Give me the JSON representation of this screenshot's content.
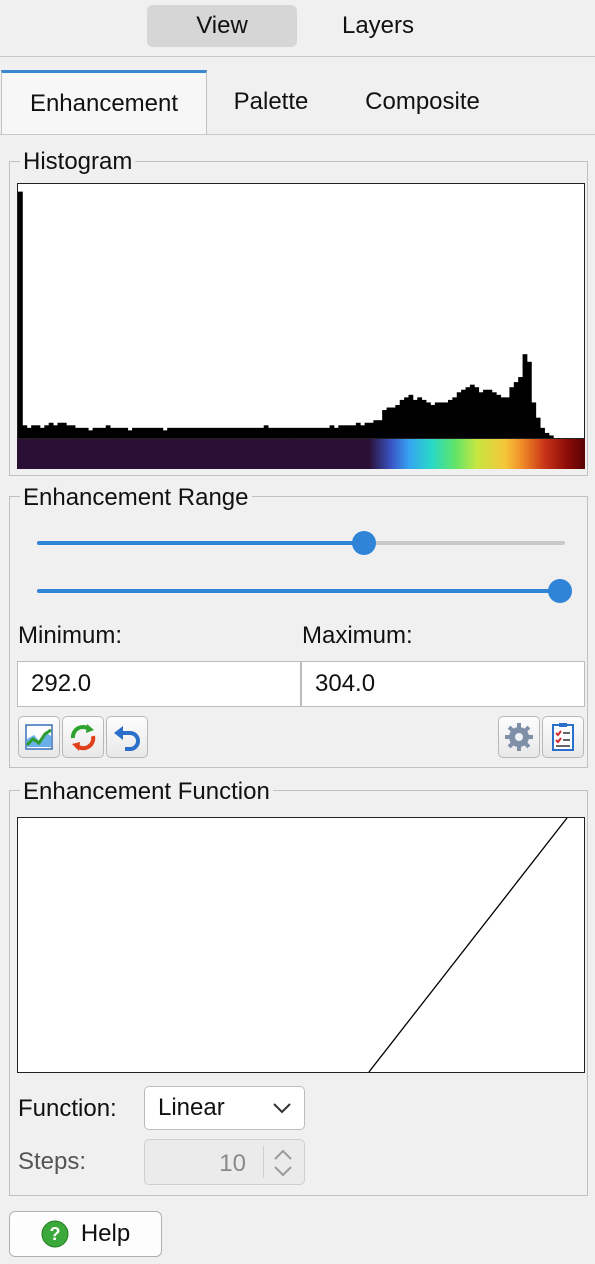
{
  "top_tabs": {
    "view": "View",
    "layers": "Layers"
  },
  "tabs": {
    "enhancement": "Enhancement",
    "palette": "Palette",
    "composite": "Composite"
  },
  "histogram": {
    "title": "Histogram",
    "bins": [
      97,
      5,
      4,
      5,
      5,
      4,
      5,
      6,
      5,
      6,
      6,
      5,
      5,
      4,
      4,
      4,
      3,
      4,
      4,
      4,
      5,
      4,
      4,
      4,
      4,
      3,
      4,
      4,
      4,
      4,
      4,
      4,
      4,
      3,
      4,
      4,
      4,
      4,
      4,
      4,
      4,
      4,
      4,
      4,
      4,
      4,
      4,
      4,
      4,
      4,
      4,
      4,
      4,
      4,
      4,
      4,
      5,
      4,
      4,
      4,
      4,
      4,
      4,
      4,
      4,
      4,
      4,
      4,
      4,
      4,
      4,
      5,
      4,
      5,
      5,
      5,
      5,
      6,
      5,
      6,
      6,
      7,
      7,
      11,
      12,
      12,
      13,
      15,
      16,
      17,
      15,
      16,
      15,
      14,
      13,
      14,
      14,
      14,
      15,
      16,
      18,
      19,
      20,
      21,
      20,
      18,
      19,
      19,
      18,
      17,
      16,
      16,
      20,
      22,
      24,
      33,
      30,
      14,
      8,
      4,
      2,
      1,
      0,
      0,
      0,
      0,
      0,
      0,
      0
    ]
  },
  "range": {
    "title": "Enhancement Range",
    "min_slider_fraction": 0.62,
    "max_slider_fraction": 0.99,
    "minimum_label": "Minimum:",
    "maximum_label": "Maximum:",
    "minimum_value": "292.0",
    "maximum_value": "304.0",
    "icons": [
      "chart-icon",
      "refresh-icon",
      "undo-icon",
      "gear-icon",
      "checklist-icon"
    ]
  },
  "function": {
    "title": "Enhancement Function",
    "curve_start_fraction": 0.62,
    "curve_end_fraction": 0.97,
    "function_label": "Function:",
    "function_value": "Linear",
    "steps_label": "Steps:",
    "steps_value": "10"
  },
  "help": {
    "label": "Help"
  },
  "colors": {
    "accent": "#2f84d8",
    "track": "#c9c9c9"
  }
}
